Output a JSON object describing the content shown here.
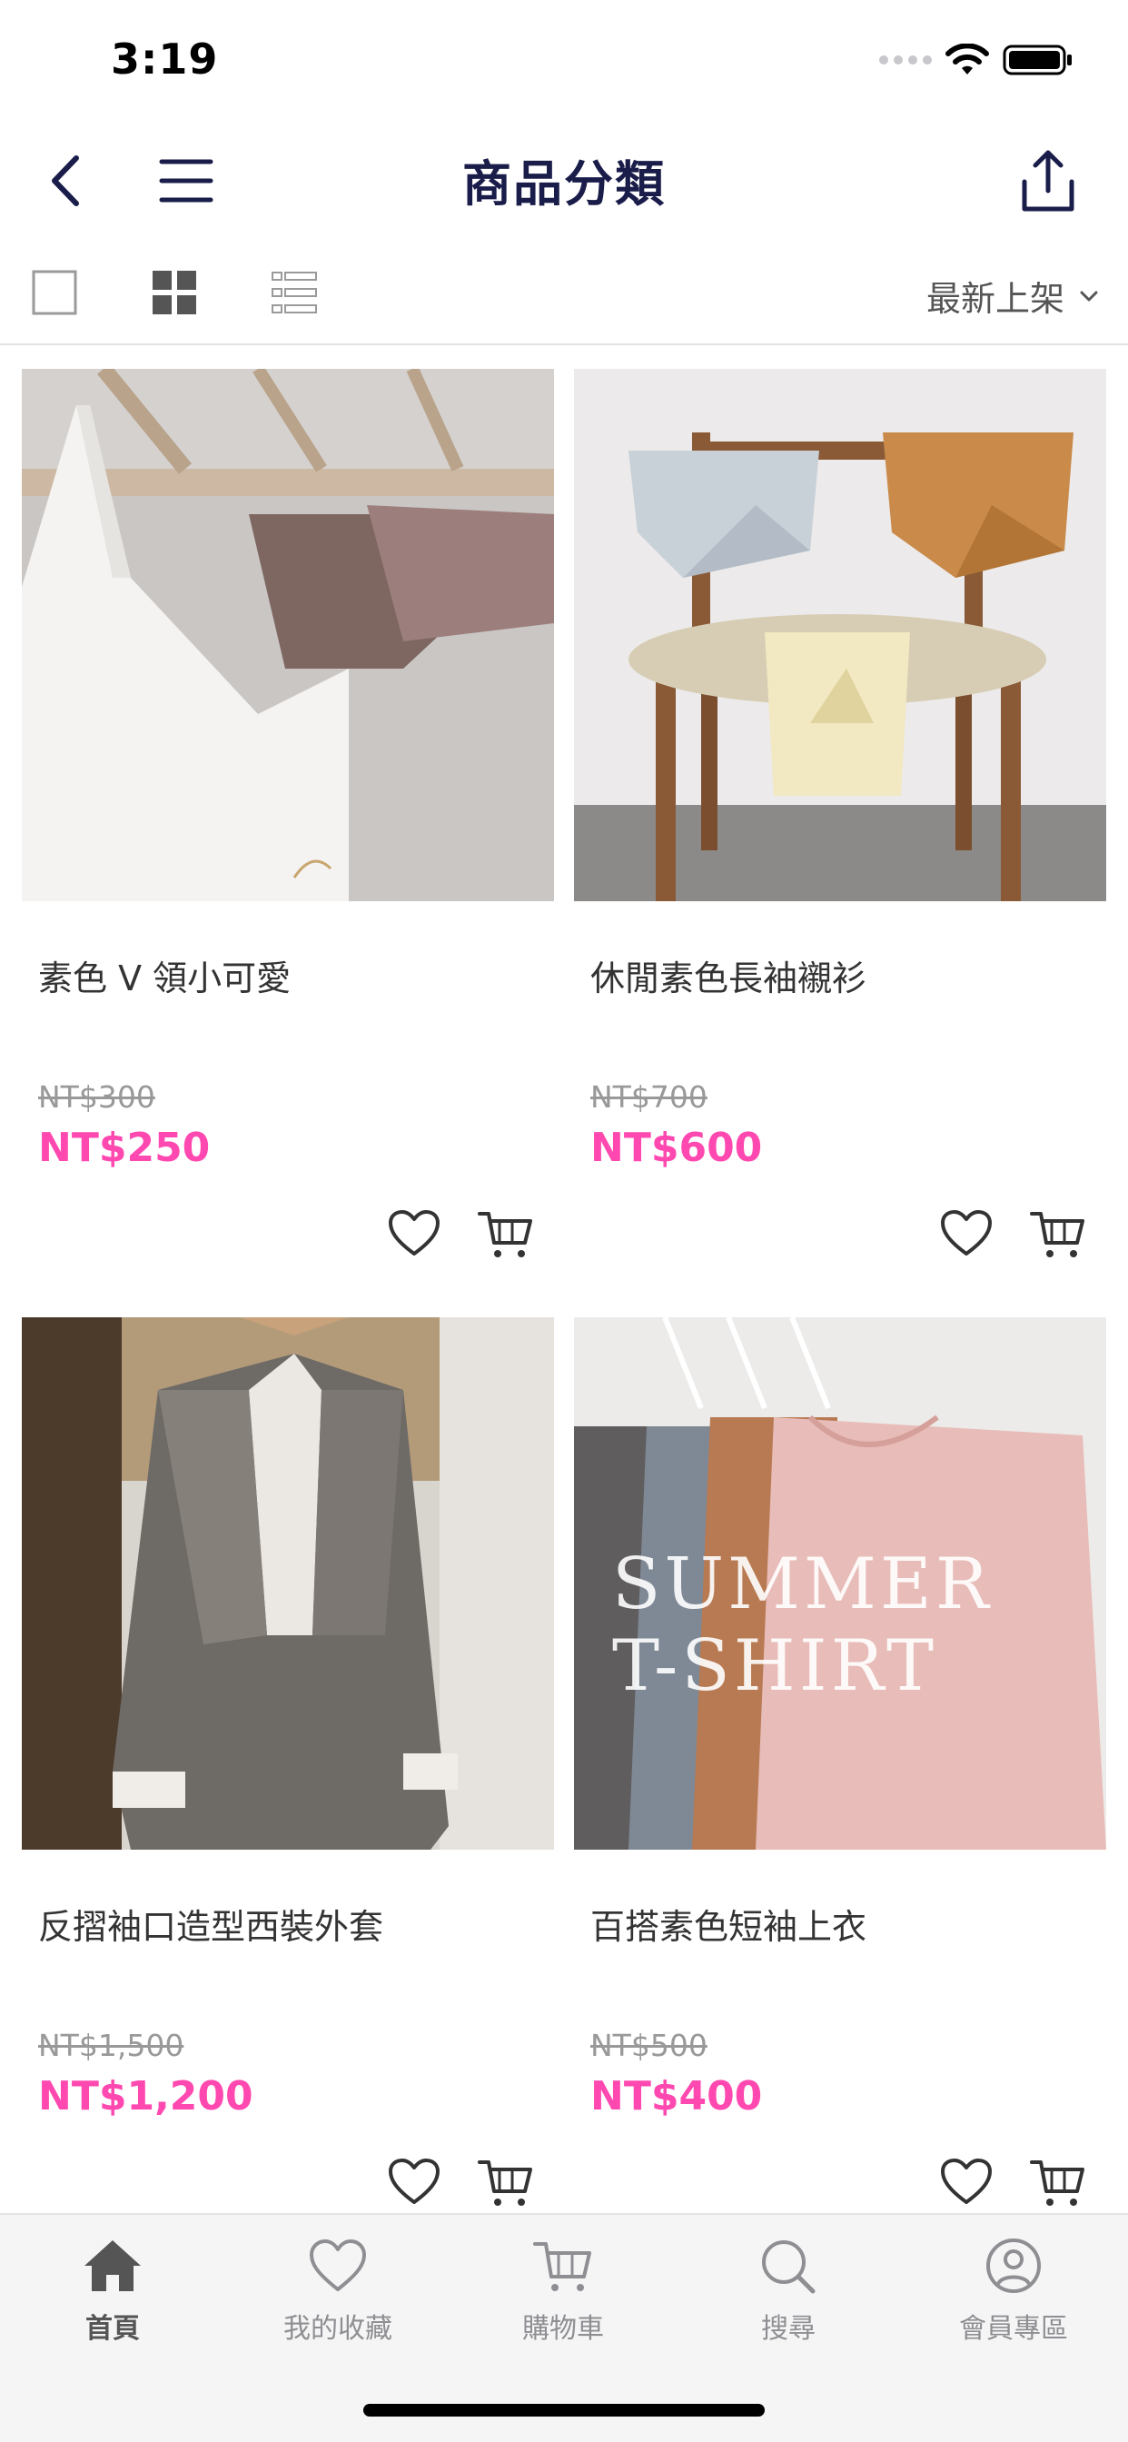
{
  "status_bar": {
    "time": "3:19"
  },
  "nav": {
    "title": "商品分類"
  },
  "toolbar": {
    "sort_label": "最新上架"
  },
  "products": [
    {
      "name": "素色 V 領小可愛",
      "original_price": "NT$300",
      "price": "NT$250"
    },
    {
      "name": "休閒素色長袖襯衫",
      "original_price": "NT$700",
      "price": "NT$600"
    },
    {
      "name": "反摺袖口造型西裝外套",
      "original_price": "NT$1,500",
      "price": "NT$1,200"
    },
    {
      "name": "百搭素色短袖上衣",
      "original_price": "NT$500",
      "price": "NT$400",
      "image_text_1": "SUMMER",
      "image_text_2": "T-SHIRT"
    }
  ],
  "tab_bar": {
    "home": "首頁",
    "favorites": "我的收藏",
    "cart": "購物車",
    "search": "搜尋",
    "member": "會員專區"
  },
  "colors": {
    "accent_price": "#ff49b0",
    "title": "#1a1d4a",
    "icon": "#333333"
  }
}
